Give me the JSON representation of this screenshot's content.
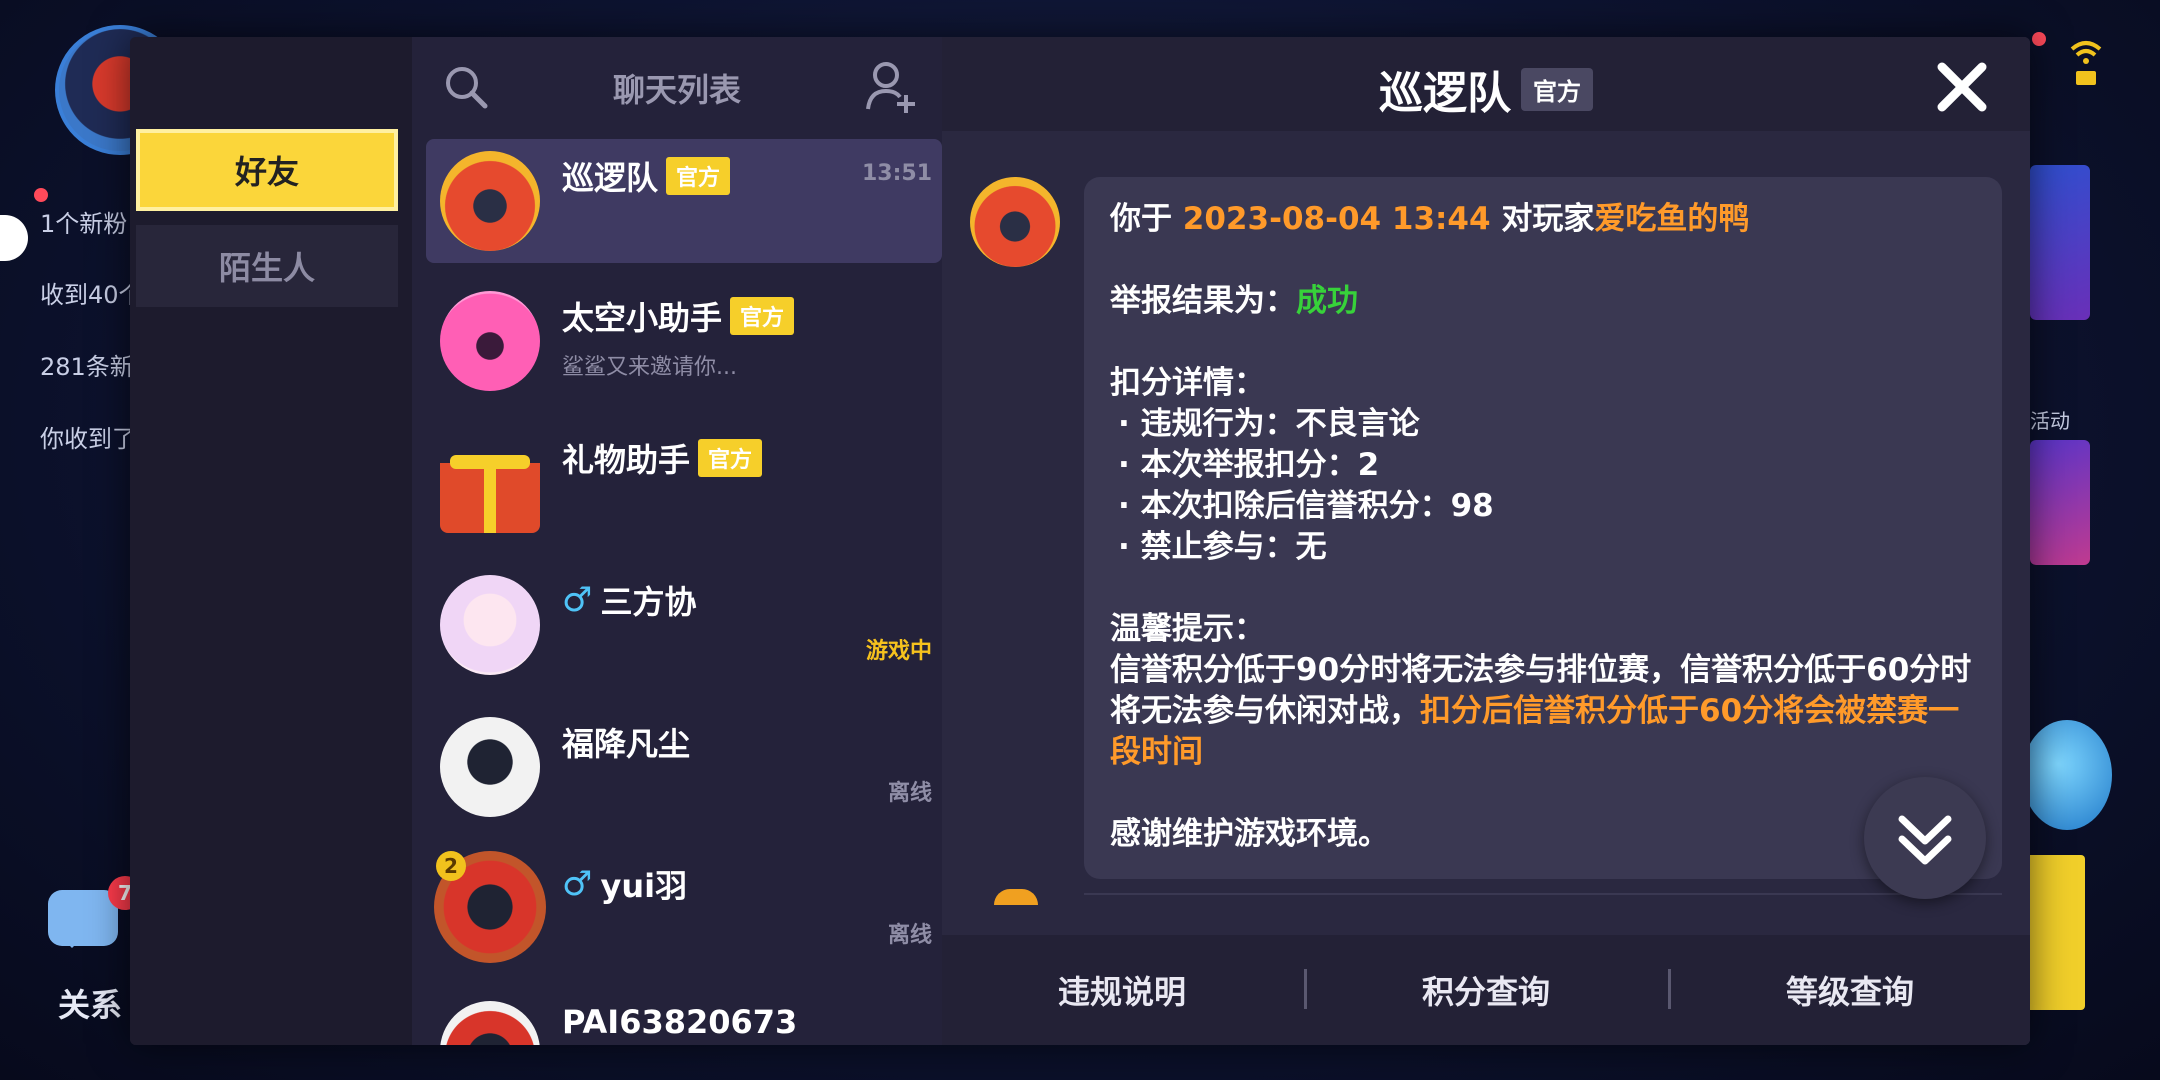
{
  "background": {
    "side_notices": [
      "1个新粉",
      "收到40个",
      "281条新",
      "你收到了"
    ],
    "chat_badge": "7",
    "guanxi_label": "关系",
    "right_label": "活动"
  },
  "tabs": {
    "friends": "好友",
    "strangers": "陌生人"
  },
  "chat_list": {
    "title": "聊天列表",
    "items": [
      {
        "name": "巡逻队",
        "tag": "官方",
        "time": "13:51",
        "sub": "",
        "status": ""
      },
      {
        "name": "太空小助手",
        "tag": "官方",
        "time": "",
        "sub": "鲨鲨又来邀请你...",
        "status": ""
      },
      {
        "name": "礼物助手",
        "tag": "官方",
        "time": "",
        "sub": "",
        "status": ""
      },
      {
        "name": "三方协",
        "gender": "♂",
        "time": "",
        "sub": "",
        "status": "游戏中"
      },
      {
        "name": "福降凡尘",
        "time": "",
        "sub": "",
        "status": "离线"
      },
      {
        "name": "yui羽",
        "gender": "♂",
        "level": "2",
        "time": "",
        "sub": "",
        "status": "离线"
      },
      {
        "name": "PAI63820673",
        "time": "",
        "sub": "",
        "status": ""
      }
    ]
  },
  "chat": {
    "title": "巡逻队",
    "title_tag": "官方",
    "message": {
      "line1_prefix": "你于 ",
      "line1_datetime": "2023-08-04 13:44",
      "line1_mid": " 对玩家",
      "line1_player": "爱吃鱼的鸭",
      "result_label": "举报结果为：",
      "result_value": "成功",
      "deduct_title": "扣分详情：",
      "bullets": [
        "·  违规行为：不良言论",
        "·  本次举报扣分：2",
        "·  本次扣除后信誉积分：98",
        "·  禁止参与：无"
      ],
      "tip_title": "温馨提示：",
      "tip_normal": "信誉积分低于90分时将无法参与排位赛，信誉积分低于60分时将无法参与休闲对战，",
      "tip_highlight": "扣分后信誉积分低于60分将会被禁赛一段时间",
      "thanks": "感谢维护游戏环境。"
    },
    "footer": {
      "rules": "违规说明",
      "points": "积分查询",
      "level": "等级查询"
    }
  },
  "colors": {
    "accent_yellow": "#fbd63a",
    "highlight_orange": "#ff9a2a",
    "success_green": "#37d23a",
    "ingame_yellow": "#f6c21d"
  }
}
